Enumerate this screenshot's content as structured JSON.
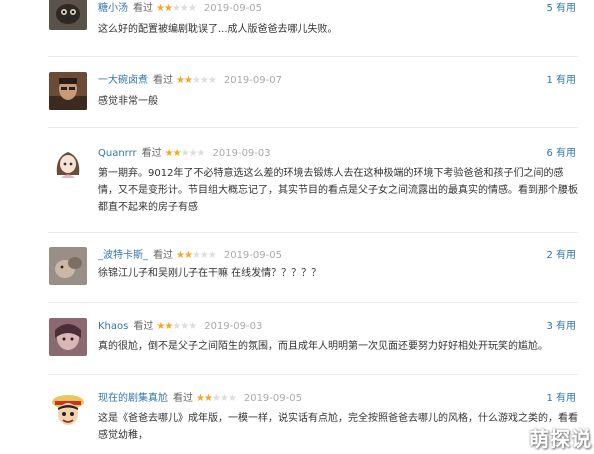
{
  "reviews": [
    {
      "user": "糖小汤",
      "action": "看过",
      "rating": 2,
      "date": "2019-09-05",
      "useful": "5 有用",
      "content": "这么好的配置被编剧耽误了...成人版爸爸去哪儿失败。"
    },
    {
      "user": "一大碗卤煮",
      "action": "看过",
      "rating": 2,
      "date": "2019-09-07",
      "useful": "1 有用",
      "content": "感觉非常一般"
    },
    {
      "user": "Quanrrr",
      "action": "看过",
      "rating": 2,
      "date": "2019-09-03",
      "useful": "6 有用",
      "content": "第一期弃。9012年了不必特意选这么差的环境去锻炼人去在这种极端的环境下考验爸爸和孩子们之间的感情，又不是变形计。节目组大概忘记了，其实节目的看点是父子女之间流露出的最真实的情感。看到那个腰板都直不起来的房子有感"
    },
    {
      "user": "_波特卡斯_",
      "action": "看过",
      "rating": 2,
      "date": "2019-09-05",
      "useful": "2 有用",
      "content": "徐锦江儿子和吴刚儿子在干嘛 在线发情？？？？？"
    },
    {
      "user": "Khaos",
      "action": "看过",
      "rating": 2,
      "date": "2019-09-03",
      "useful": "3 有用",
      "content": "真的很尬，倒不是父子之间陌生的氛围，而且成年人明明第一次见面还要努力好好相处开玩笑的尴尬。"
    },
    {
      "user": "现在的剧集真尬",
      "action": "看过",
      "rating": 2,
      "date": "2019-09-05",
      "useful": "1 有用",
      "content": "这是《爸爸去哪儿》成年版，一模一样，说实话有点尬，完全按照爸爸去哪儿的风格，什么游戏之类的，看看感觉幼稚，"
    }
  ],
  "star_glyph": "★",
  "max_rating": 5,
  "watermark": "萌探说",
  "colors": {
    "username": "#3377aa",
    "star_on": "#f5a623",
    "star_off": "#dddddd",
    "date": "#aaaaaa",
    "text": "#333333"
  }
}
